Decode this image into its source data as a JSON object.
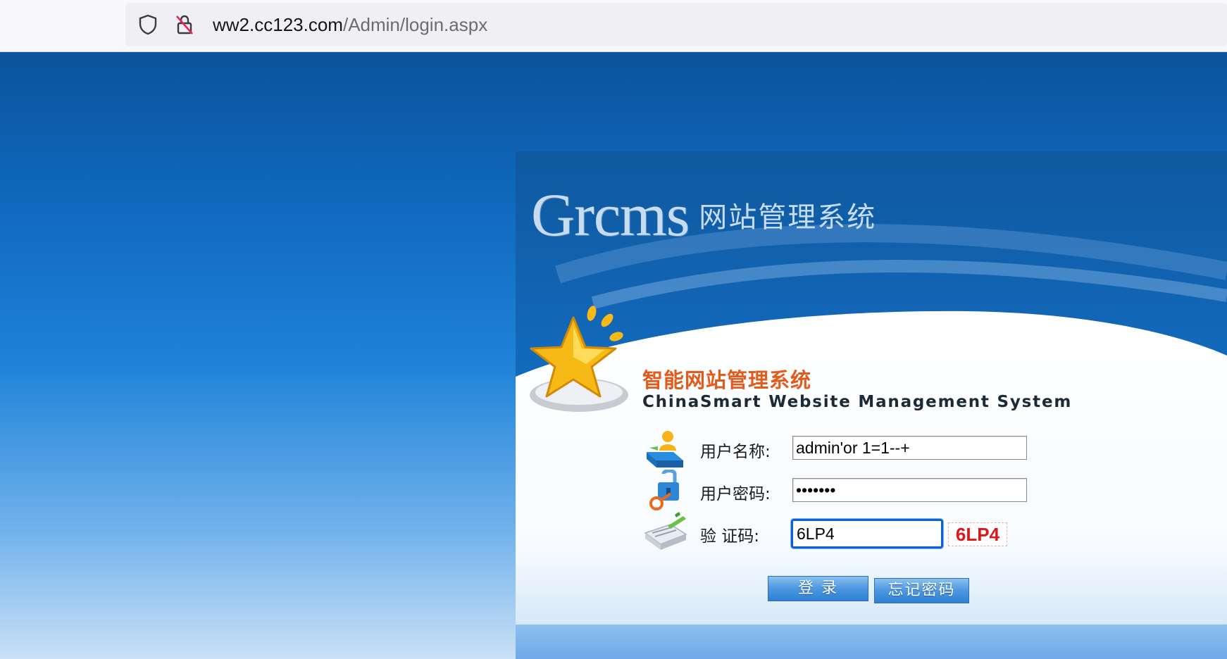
{
  "browser": {
    "url_host": "ww2.cc123.com",
    "url_path": "/Admin/login.aspx",
    "icons": [
      "shield-icon",
      "insecure-lock-icon"
    ]
  },
  "login": {
    "logo_main": "Grcms",
    "logo_sub": "网站管理系统",
    "system_name_cn": "智能网站管理系统",
    "system_name_en": "ChinaSmart Website Management System",
    "username_label": "用户名称:",
    "username_value": "admin'or 1=1--+",
    "password_label": "用户密码:",
    "password_value": "•••••••",
    "captcha_label": "验 证码:",
    "captcha_value": "6LP4",
    "captcha_image_text": "6LP4",
    "login_button": "登 录",
    "forgot_button": "忘记密码",
    "icons": [
      "star-icon",
      "user-icon",
      "key-icon",
      "verify-icon"
    ]
  },
  "colors": {
    "accent_orange": "#e25b1c",
    "captcha_red": "#e01515",
    "focus_blue": "#0a62d6",
    "background_blue": "#0e63b6"
  }
}
